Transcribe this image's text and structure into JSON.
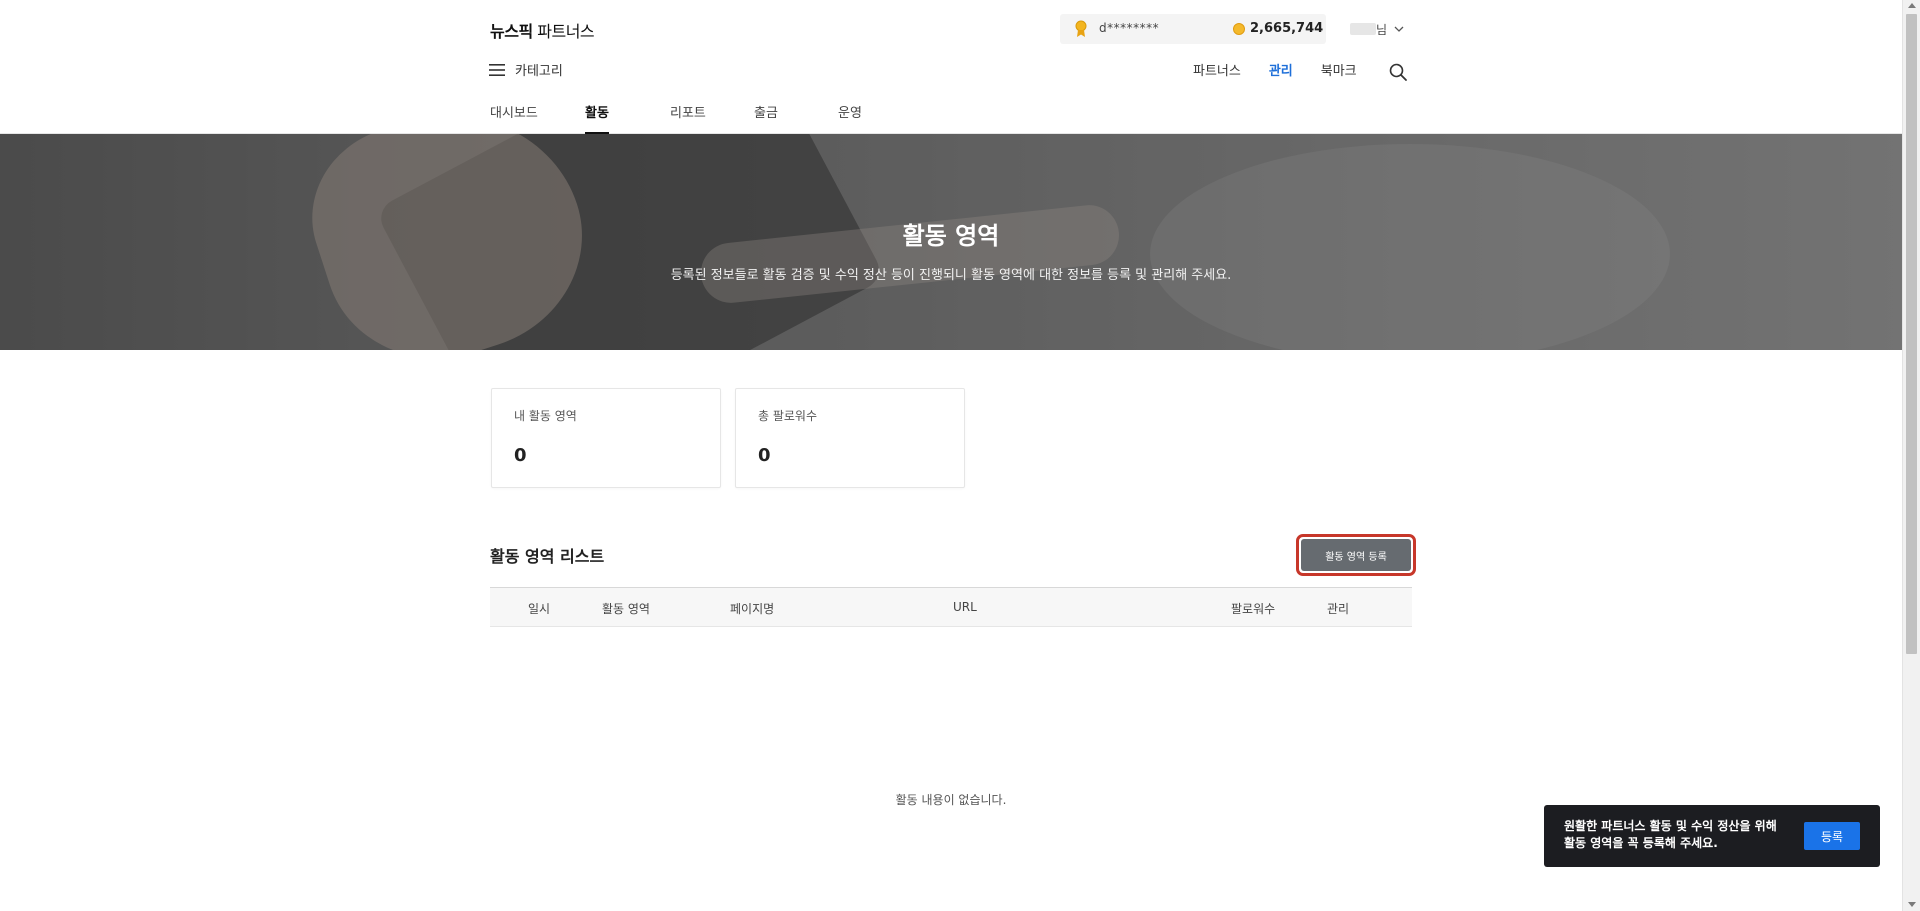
{
  "header": {
    "logo_bold": "뉴스픽",
    "logo_light": " 파트너스",
    "user_id_masked": "d********",
    "points": "2,665,744",
    "user_suffix": "님",
    "menu_label": "카테고리",
    "nav": [
      {
        "label": "파트너스",
        "active": false
      },
      {
        "label": "관리",
        "active": true
      },
      {
        "label": "북마크",
        "active": false
      }
    ],
    "tabs": [
      {
        "label": "대시보드"
      },
      {
        "label": "활동"
      },
      {
        "label": "리포트"
      },
      {
        "label": "출금"
      },
      {
        "label": "운영"
      }
    ],
    "active_tab": "활동"
  },
  "hero": {
    "title": "활동 영역",
    "description": "등록된 정보들로 활동 검증 및 수익 정산 등이 진행되니 활동 영역에 대한 정보를 등록 및 관리해 주세요."
  },
  "stats": [
    {
      "label": "내 활동 영역",
      "value": "0"
    },
    {
      "label": "총 팔로워수",
      "value": "0"
    }
  ],
  "list": {
    "title": "활동 영역 리스트",
    "register_button": "활동 영역 등록",
    "columns": [
      "일시",
      "활동 영역",
      "페이지명",
      "URL",
      "팔로워수",
      "관리"
    ],
    "rows": [],
    "empty_message": "활동 내용이 없습니다."
  },
  "toast": {
    "message": "원활한 파트너스 활동 및 수익 정산을 위해 활동 영역을 꼭 등록해 주세요.",
    "button": "등록"
  },
  "colors": {
    "accent": "#1e6fd9",
    "toast_button": "#1a73e8",
    "register_button": "#666b70",
    "highlight_outline": "#c7372a",
    "toast_bg": "#1c1d21"
  },
  "icons": [
    "medal-icon",
    "coin-icon",
    "chevron-down-icon",
    "hamburger-icon",
    "search-icon"
  ]
}
